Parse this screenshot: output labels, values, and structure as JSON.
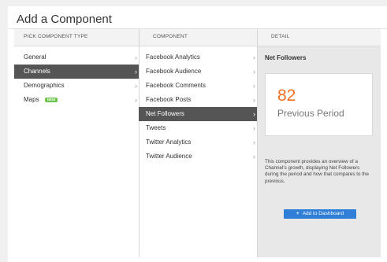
{
  "dialog": {
    "title": "Add a Component"
  },
  "columns": {
    "type_header": "PICK COMPONENT TYPE",
    "component_header": "COMPONENT",
    "detail_header": "DETAIL"
  },
  "types": [
    {
      "label": "General",
      "active": false
    },
    {
      "label": "Channels",
      "active": true
    },
    {
      "label": "Demographics",
      "active": false
    },
    {
      "label": "Maps",
      "badge": "NEW",
      "active": false
    }
  ],
  "components": [
    {
      "label": "Facebook Analytics",
      "active": false
    },
    {
      "label": "Facebook Audience",
      "active": false
    },
    {
      "label": "Facebook Comments",
      "active": false
    },
    {
      "label": "Facebook Posts",
      "active": false
    },
    {
      "label": "Net Followers",
      "active": true
    },
    {
      "label": "Tweets",
      "active": false
    },
    {
      "label": "Twitter Analytics",
      "active": false
    },
    {
      "label": "Twitter Audience",
      "active": false
    }
  ],
  "detail": {
    "title": "Net Followers",
    "value": "82",
    "caption": "Previous Period",
    "description": "This component provides an overview of a Channel's growth, displaying Net Followers during the period and how that compares to the previous.",
    "button_label": "Add to Dashboard",
    "button_icon": "plus-icon",
    "value_color": "#f26f22",
    "button_color": "#2f7fd8"
  },
  "chevron": "›"
}
